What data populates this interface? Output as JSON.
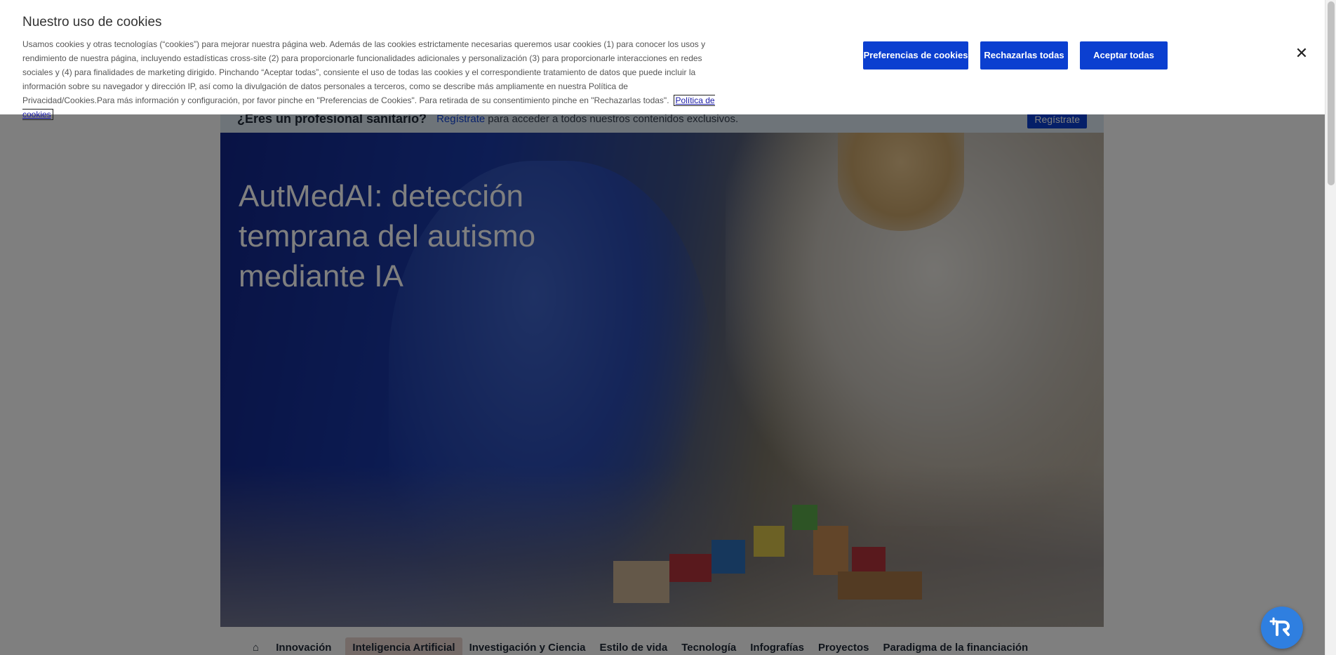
{
  "registration_bar": {
    "question": "¿Eres un profesional sanitario?",
    "link": "Regístrate",
    "text": "para acceder a todos nuestros contenidos exclusivos.",
    "button": "Regístrate"
  },
  "hero": {
    "title": "AutMedAI: detección temprana del autismo mediante IA"
  },
  "nav": {
    "items": [
      "Innovación",
      "Inteligencia Artificial",
      "Investigación y Ciencia",
      "Estilo de vida",
      "Tecnología",
      "Infografías",
      "Proyectos",
      "Paradigma de la financiación"
    ],
    "active_index": 1
  },
  "cookie_banner": {
    "title": "Nuestro uso de cookies",
    "body": "Usamos cookies y otras tecnologías (“cookies”) para mejorar nuestra página web. Además de las cookies estrictamente necesarias queremos usar cookies (1) para conocer los usos y rendimiento de nuestra página, incluyendo estadísticas cross-site (2) para proporcionarle funcionalidades adicionales y personalización (3) para proporcionarle interacciones en redes sociales y (4) para finalidades de marketing dirigido. Pinchando “Aceptar todas”, consiente el uso de todas las cookies y el correspondiente tratamiento de datos que puede incluir la información sobre su navegador y dirección IP, así como la divulgación de datos personales a terceros, como se describe más ampliamente en nuestra Política de Privacidad/Cookies.Para más información y configuración, por favor pinche en \"Preferencias de Cookies\". Para retirada de su consentimiento pinche en \"Rechazarlas todas\".",
    "policy_link": "Política de cookies",
    "buttons": {
      "preferences": "Preferencias de cookies",
      "reject": "Rechazarlas todas",
      "accept": "Aceptar todas"
    },
    "close_icon": "close-icon"
  },
  "colors": {
    "primary_button": "#0b3fd0",
    "fab": "#2f7fe0"
  }
}
